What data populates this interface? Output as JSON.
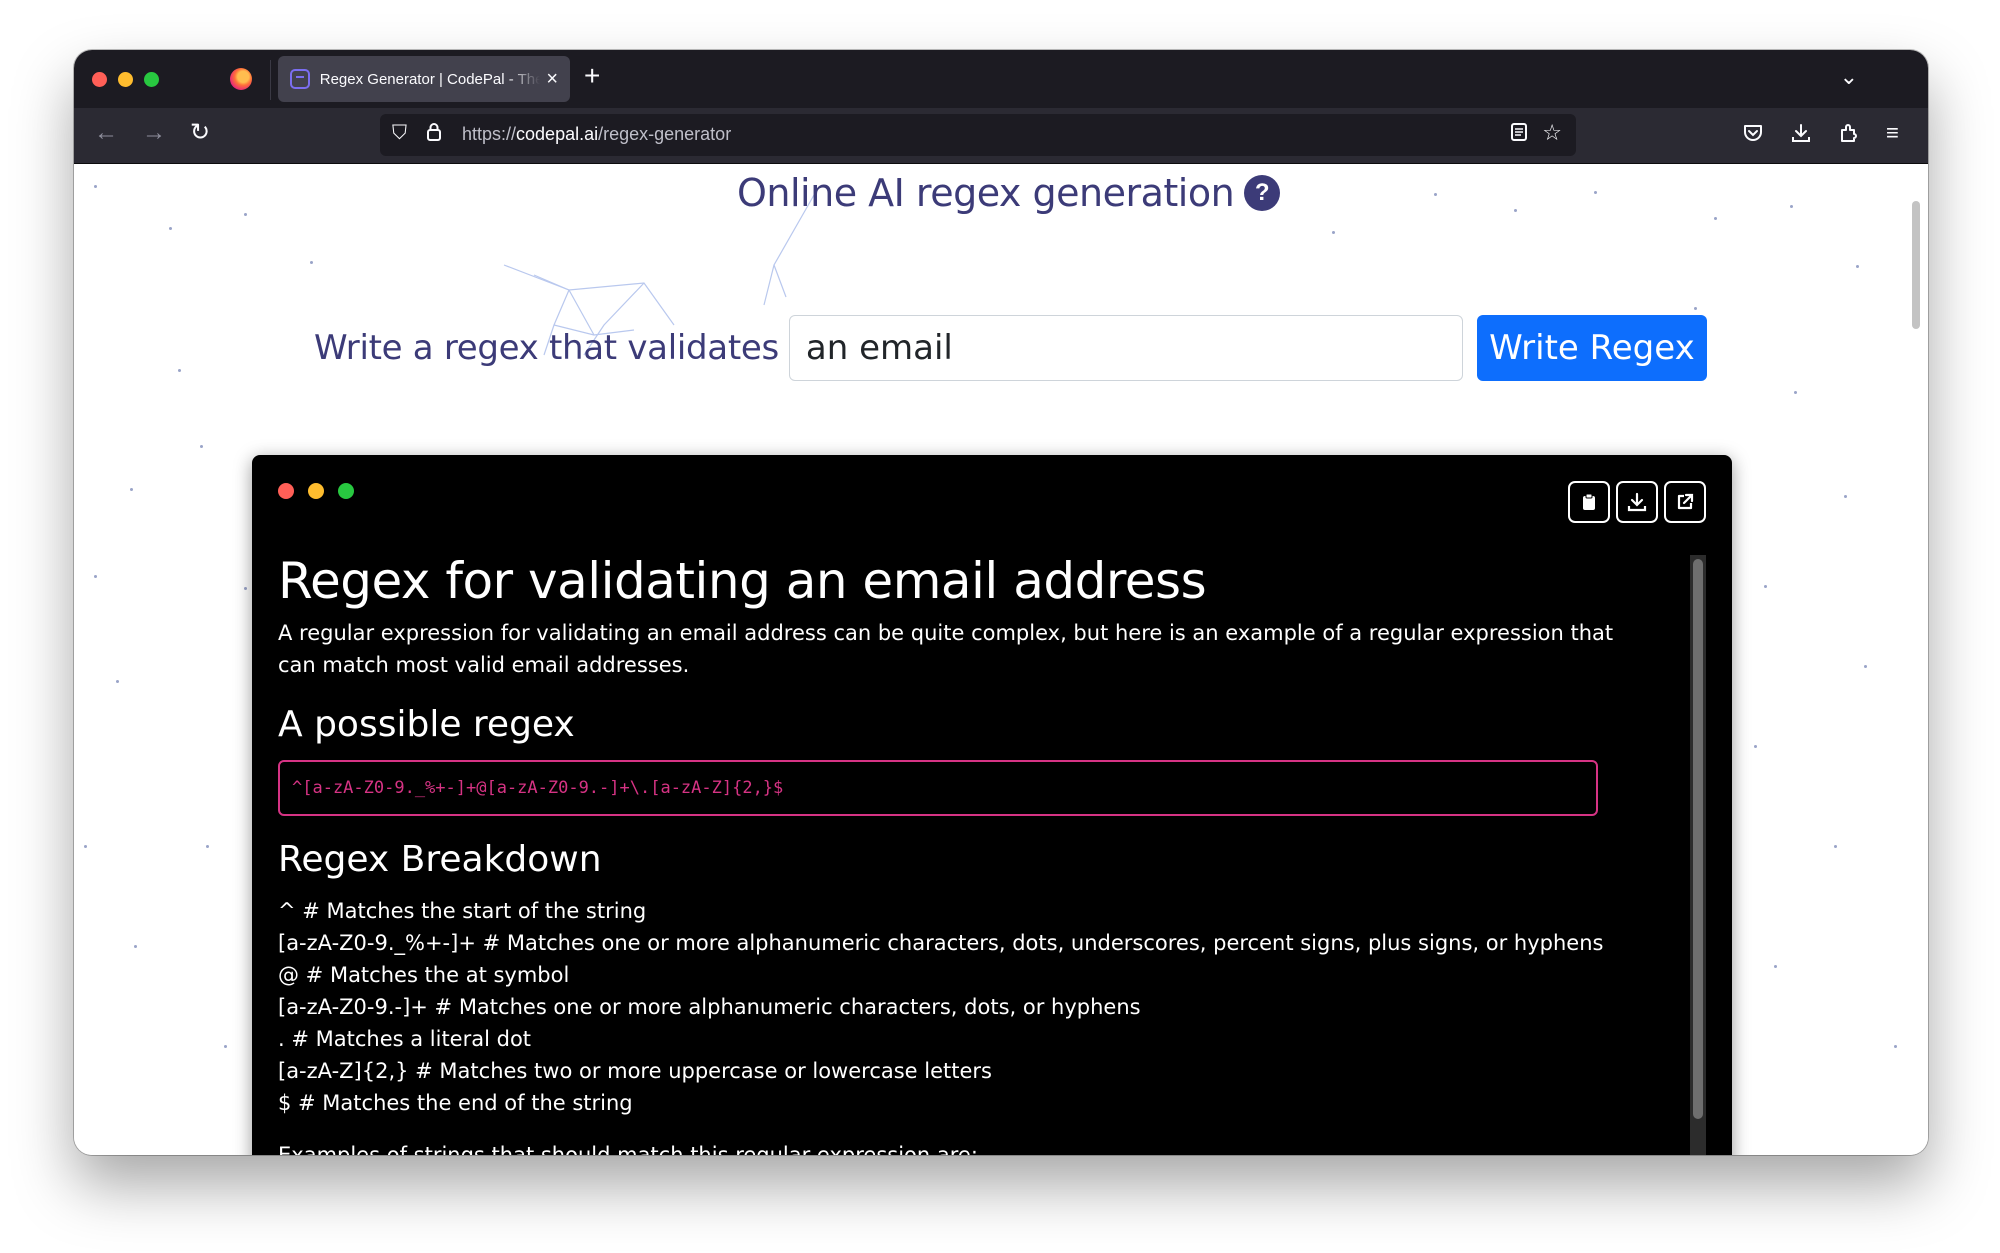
{
  "browser": {
    "tab_title": "Regex Generator | CodePal - The",
    "new_tab_label": "+",
    "url_scheme": "https://",
    "url_domain": "codepal.ai",
    "url_path": "/regex-generator"
  },
  "page": {
    "title": "Online AI regex generation",
    "help_label": "?",
    "prompt_label": "Write a regex that validates",
    "prompt_value": "an email",
    "submit_label": "Write Regex"
  },
  "result": {
    "heading": "Regex for validating an email address",
    "intro": "A regular expression for validating an email address can be quite complex, but here is an example of a regular expression that can match most valid email addresses.",
    "regex_heading": "A possible regex",
    "regex": "^[a-zA-Z0-9._%+-]+@[a-zA-Z0-9.-]+\\.[a-zA-Z]{2,}$",
    "breakdown_heading": "Regex Breakdown",
    "breakdown": [
      "^ # Matches the start of the string",
      "[a-zA-Z0-9._%+-]+ # Matches one or more alphanumeric characters, dots, underscores, percent signs, plus signs, or hyphens",
      "@ # Matches the at symbol",
      "[a-zA-Z0-9.-]+ # Matches one or more alphanumeric characters, dots, or hyphens",
      ". # Matches a literal dot",
      "[a-zA-Z]{2,} # Matches two or more uppercase or lowercase letters",
      "$ # Matches the end of the string"
    ],
    "examples_intro": "Examples of strings that should match this regular expression are:"
  },
  "colors": {
    "accent": "#0d6efd",
    "title_color": "#3c3b78",
    "code_color": "#d63384"
  }
}
